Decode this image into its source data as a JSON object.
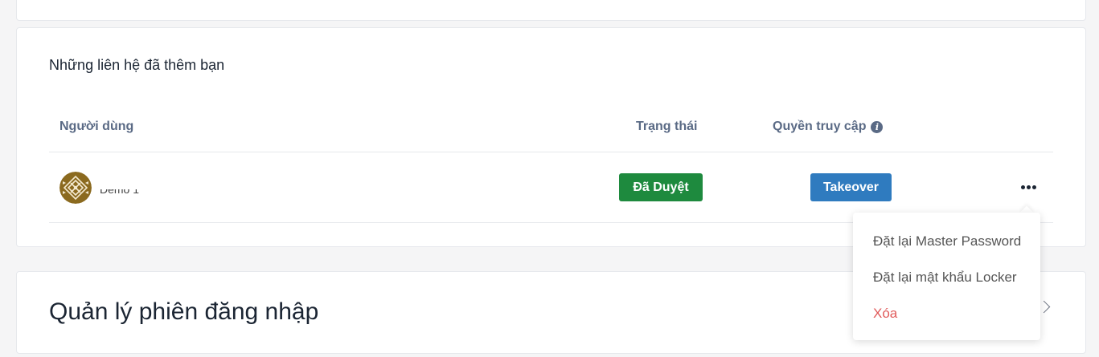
{
  "contacts_section": {
    "title": "Những liên hệ đã thêm bạn",
    "columns": {
      "user": "Người dùng",
      "status": "Trạng thái",
      "access": "Quyền truy cập"
    },
    "rows": [
      {
        "user_name": "Demo 1",
        "status": "Đã Duyệt",
        "access": "Takeover"
      }
    ]
  },
  "row_menu": {
    "items": [
      "Đặt lại Master Password",
      "Đặt lại mật khẩu Locker",
      "Xóa"
    ]
  },
  "sessions_section": {
    "title": "Quản lý phiên đăng nhập"
  },
  "colors": {
    "approved": "#1e8a3e",
    "takeover": "#2f7bbf",
    "delete": "#e05a5a",
    "header_text": "#5a6a85",
    "avatar": "#8b6a1f"
  },
  "icons": {
    "info": "info-icon",
    "more": "more-horizontal-icon",
    "chevron": "chevron-right-icon"
  }
}
